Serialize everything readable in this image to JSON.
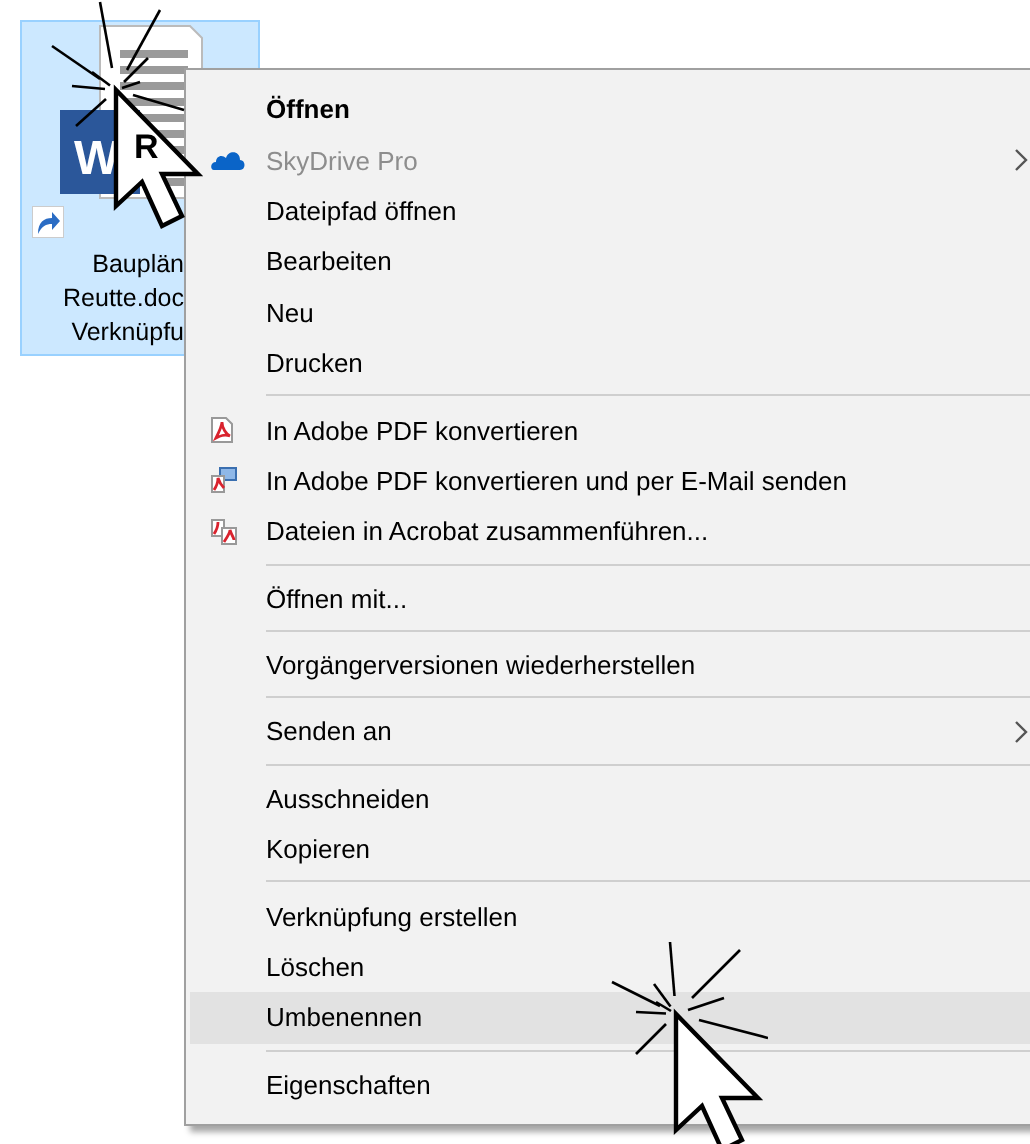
{
  "desktop_icon": {
    "selected": true,
    "shortcut": true,
    "logo_letter": "W",
    "label_lines": [
      "Bauplän",
      "Reutte.doc",
      "Verknüpfu"
    ]
  },
  "cursors": [
    {
      "kind": "right-click",
      "label": "R"
    },
    {
      "kind": "left-click"
    }
  ],
  "context_menu": {
    "groups": [
      [
        {
          "label": "Öffnen",
          "kind": "plain",
          "default": true,
          "disabled": false,
          "submenu": false,
          "selected": false
        },
        {
          "label": "SkyDrive Pro",
          "kind": "cloud",
          "default": false,
          "disabled": true,
          "submenu": true,
          "selected": false
        },
        {
          "label": "Dateipfad öffnen",
          "kind": "plain",
          "default": false,
          "disabled": false,
          "submenu": false,
          "selected": false
        },
        {
          "label": "Bearbeiten",
          "kind": "plain",
          "default": false,
          "disabled": false,
          "submenu": false,
          "selected": false
        },
        {
          "label": "Neu",
          "kind": "plain",
          "default": false,
          "disabled": false,
          "submenu": false,
          "selected": false
        },
        {
          "label": "Drucken",
          "kind": "plain",
          "default": false,
          "disabled": false,
          "submenu": false,
          "selected": false
        }
      ],
      [
        {
          "label": "In Adobe PDF konvertieren",
          "kind": "pdf",
          "default": false,
          "disabled": false,
          "submenu": false,
          "selected": false
        },
        {
          "label": "In Adobe PDF konvertieren und per E-Mail senden",
          "kind": "pdfmail",
          "default": false,
          "disabled": false,
          "submenu": false,
          "selected": false
        },
        {
          "label": "Dateien in Acrobat zusammenführen...",
          "kind": "pdfcombine",
          "default": false,
          "disabled": false,
          "submenu": false,
          "selected": false
        }
      ],
      [
        {
          "label": "Öffnen mit...",
          "kind": "plain",
          "default": false,
          "disabled": false,
          "submenu": false,
          "selected": false
        }
      ],
      [
        {
          "label": "Vorgängerversionen wiederherstellen",
          "kind": "plain",
          "default": false,
          "disabled": false,
          "submenu": false,
          "selected": false
        }
      ],
      [
        {
          "label": "Senden an",
          "kind": "plain",
          "default": false,
          "disabled": false,
          "submenu": true,
          "selected": false
        }
      ],
      [
        {
          "label": "Ausschneiden",
          "kind": "plain",
          "default": false,
          "disabled": false,
          "submenu": false,
          "selected": false
        },
        {
          "label": "Kopieren",
          "kind": "plain",
          "default": false,
          "disabled": false,
          "submenu": false,
          "selected": false
        }
      ],
      [
        {
          "label": "Verknüpfung erstellen",
          "kind": "plain",
          "default": false,
          "disabled": false,
          "submenu": false,
          "selected": false
        },
        {
          "label": "Löschen",
          "kind": "plain",
          "default": false,
          "disabled": false,
          "submenu": false,
          "selected": false
        },
        {
          "label": "Umbenennen",
          "kind": "plain",
          "default": false,
          "disabled": false,
          "submenu": false,
          "selected": true
        }
      ],
      [
        {
          "label": "Eigenschaften",
          "kind": "plain",
          "default": false,
          "disabled": false,
          "submenu": false,
          "selected": false
        }
      ]
    ]
  }
}
